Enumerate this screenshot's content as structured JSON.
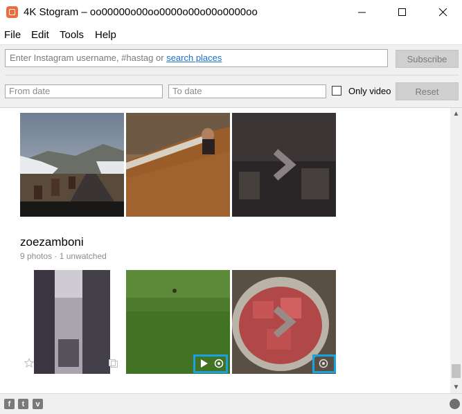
{
  "window": {
    "title": "4K Stogram – oo00000o00oo0000o00o00o0000oo"
  },
  "menu": [
    "File",
    "Edit",
    "Tools",
    "Help"
  ],
  "search": {
    "placeholder": "Enter Instagram username, #hastag or",
    "link": "search places",
    "subscribe_label": "Subscribe"
  },
  "filters": {
    "from_placeholder": "From date",
    "to_placeholder": "To date",
    "only_video_label": "Only video",
    "reset_label": "Reset"
  },
  "feed": {
    "account": {
      "username": "zoezamboni",
      "photo_count": "9 photos",
      "separator": "·",
      "unwatched": "1 unwatched"
    }
  },
  "icons": {
    "more_arrow": "chevron-right-icon",
    "play": "play-icon",
    "watched": "eye-icon",
    "star": "star-icon",
    "copy": "copy-icon",
    "facebook": "facebook-icon",
    "twitter": "twitter-icon",
    "vimeo": "vimeo-icon",
    "globe": "globe-icon"
  },
  "colors": {
    "app_accent": "#ef6c3a",
    "highlight": "#1aa1e0",
    "link": "#1a6fd0"
  }
}
